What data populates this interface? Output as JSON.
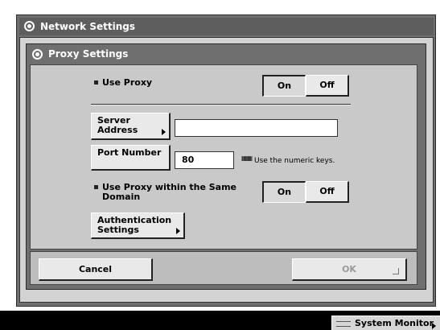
{
  "window": {
    "title": "Network Settings"
  },
  "dialog": {
    "title": "Proxy Settings"
  },
  "use_proxy": {
    "label": "Use Proxy",
    "on_label": "On",
    "off_label": "Off"
  },
  "server_address": {
    "button_label_line1": "Server",
    "button_label_line2": "Address",
    "value": ""
  },
  "port_number": {
    "button_label": "Port Number",
    "value": "80",
    "hint": "Use the numeric keys."
  },
  "same_domain": {
    "label_line1": "Use Proxy within the Same",
    "label_line2": "Domain",
    "on_label": "On",
    "off_label": "Off"
  },
  "authentication": {
    "label_line1": "Authentication",
    "label_line2": "Settings"
  },
  "footer": {
    "cancel_label": "Cancel",
    "ok_label": "OK"
  },
  "system_monitor": {
    "label": "System Monitor"
  }
}
